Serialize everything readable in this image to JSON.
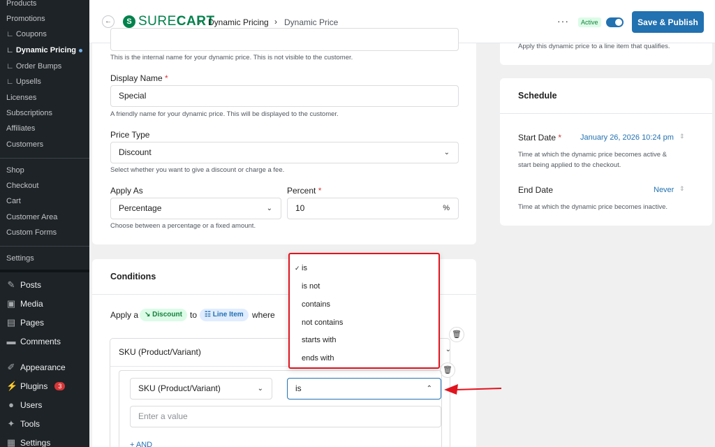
{
  "sidebar": {
    "items": [
      "Products",
      "Promotions",
      "∟ Coupons",
      "∟ Dynamic Pricing",
      "∟ Order Bumps",
      "∟ Upsells",
      "Licenses",
      "Subscriptions",
      "Affiliates",
      "Customers",
      "Shop",
      "Checkout",
      "Cart",
      "Customer Area",
      "Custom Forms",
      "Settings"
    ],
    "main": [
      "Posts",
      "Media",
      "Pages",
      "Comments",
      "Appearance",
      "Plugins",
      "Users",
      "Tools",
      "Settings"
    ],
    "plugins_badge": "3"
  },
  "header": {
    "logo_sure": "SURE",
    "logo_cart": "CART",
    "crumb1": "Dynamic Pricing",
    "crumb2": "Dynamic Price",
    "more": "···",
    "status": "Active",
    "save": "Save & Publish",
    "back": "←"
  },
  "form": {
    "name_help": "This is the internal name for your dynamic price. This is not visible to the customer.",
    "display_name_label": "Display Name",
    "display_name_value": "Special",
    "display_name_help": "A friendly name for your dynamic price. This will be displayed to the customer.",
    "price_type_label": "Price Type",
    "price_type_value": "Discount",
    "price_type_help": "Select whether you want to give a discount or charge a fee.",
    "apply_as_label": "Apply As",
    "apply_as_value": "Percentage",
    "percent_label": "Percent",
    "percent_value": "10",
    "percent_suffix": "%",
    "apply_as_help": "Choose between a percentage or a fixed amount.",
    "required": "*"
  },
  "conditions": {
    "title": "Conditions",
    "apply_a": "Apply a",
    "discount_pill": "Discount",
    "to": "to",
    "line_item_pill": "Line Item",
    "where": "where",
    "group_field": "SKU (Product/Variant)",
    "field_select": "SKU (Product/Variant)",
    "operator_select": "is",
    "value_placeholder": "Enter a value",
    "add": "+ AND",
    "options": [
      "is",
      "is not",
      "contains",
      "not contains",
      "starts with",
      "ends with"
    ],
    "check": "✓"
  },
  "right": {
    "top_help": "Apply this dynamic price to a line item that qualifies.",
    "schedule_title": "Schedule",
    "start_label": "Start Date",
    "start_value": "January 26, 2026 10:24 pm",
    "start_help_1": "Time at which the dynamic price becomes active &",
    "start_help_2": "start being applied to the checkout.",
    "end_label": "End Date",
    "end_value": "Never",
    "end_help": "Time at which the dynamic price becomes inactive."
  },
  "colors": {
    "accent": "#2271b1",
    "brand": "#01824c",
    "highlight": "#e0141e"
  }
}
